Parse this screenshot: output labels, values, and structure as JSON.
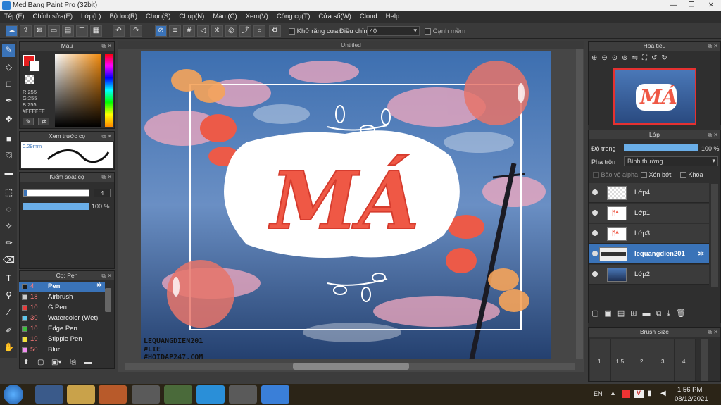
{
  "window": {
    "title": "MediBang Paint Pro (32bit)"
  },
  "menu": [
    "Tệp(F)",
    "Chỉnh sửa(E)",
    "Lớp(L)",
    "Bộ lọc(R)",
    "Chọn(S)",
    "Chụp(N)",
    "Màu (C)",
    "Xem(V)",
    "Công cụ(T)",
    "Cửa sổ(W)",
    "Cloud",
    "Help"
  ],
  "toolbar": {
    "antialias_label": "Khử răng cưa",
    "correction_label": "Điều chỉnh",
    "correction_value": "40",
    "edge_label": "Cạnh mềm"
  },
  "color_panel": {
    "title": "Màu",
    "r": "R:255",
    "g": "G:255",
    "b": "B:255",
    "hex": "#FFFFFF"
  },
  "brush_preview": {
    "title": "Xem trước cọ",
    "size": "0.29mm"
  },
  "brush_control": {
    "title": "Kiểm soát cọ",
    "size_value": "4",
    "opacity_value": "100 %"
  },
  "brush_list": {
    "title": "Cọ: Pen",
    "items": [
      {
        "size": "4",
        "name": "Pen",
        "color": "#1a1a1a"
      },
      {
        "size": "18",
        "name": "Airbrush",
        "color": "#cccccc"
      },
      {
        "size": "10",
        "name": "G Pen",
        "color": "#e63b3b"
      },
      {
        "size": "30",
        "name": "Watercolor (Wet)",
        "color": "#5ec8ef"
      },
      {
        "size": "10",
        "name": "Edge Pen",
        "color": "#3cbf3c"
      },
      {
        "size": "10",
        "name": "Stipple Pen",
        "color": "#f2e23a"
      },
      {
        "size": "50",
        "name": "Blur",
        "color": "#f38ef2"
      }
    ]
  },
  "canvas": {
    "doc_title": "Untitled",
    "art_text": "MÁ",
    "watermark": [
      "LEQUANGDIEN201",
      "#LIE",
      "#HOIDAP247.COM"
    ]
  },
  "navigator": {
    "title": "Hoa tiêu"
  },
  "layer_panel": {
    "title": "Lớp",
    "opacity_label": "Độ trong",
    "opacity_value": "100 %",
    "blend_label": "Pha trộn",
    "blend_value": "Bình thường",
    "protect_alpha": "Bảo vệ alpha",
    "clipping": "Xén bớt",
    "lock": "Khóa",
    "layers": [
      "Lớp4",
      "Lớp1",
      "Lớp3",
      "lequangdien201",
      "Lớp2"
    ]
  },
  "brush_size_panel": {
    "title": "Brush Size",
    "sizes": [
      "1",
      "1.5",
      "2",
      "3",
      "4"
    ]
  },
  "taskbar": {
    "lang": "EN",
    "time": "1:56 PM",
    "date": "08/12/2021"
  }
}
